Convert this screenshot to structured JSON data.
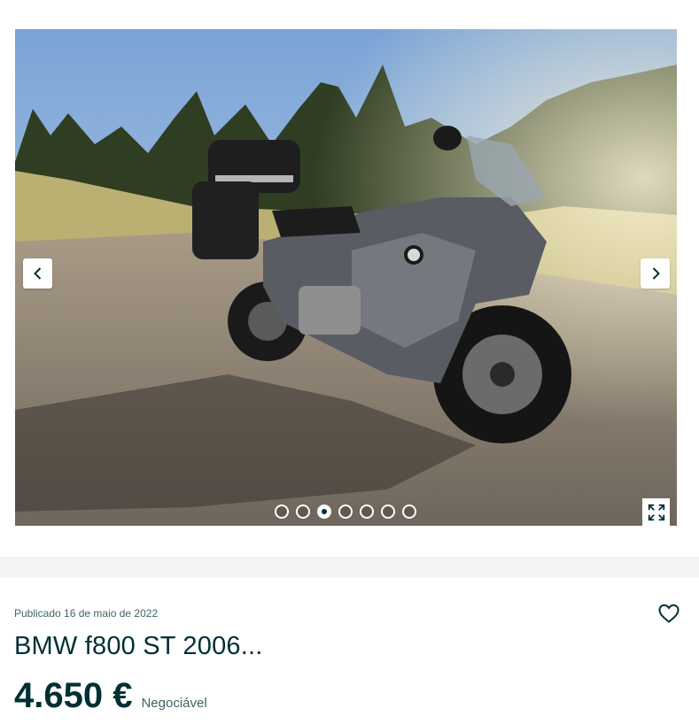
{
  "gallery": {
    "image_alt": "BMW f800 ST motorcycle parked on cobblestones",
    "prev_icon": "chevron-left-icon",
    "next_icon": "chevron-right-icon",
    "expand_icon": "expand-icon",
    "dots": {
      "total": 7,
      "active_index": 2
    }
  },
  "listing": {
    "published": "Publicado 16 de maio de 2022",
    "title": "BMW f800 ST 2006...",
    "price": "4.650 €",
    "negotiable": "Negociável",
    "favorite_icon": "heart-icon"
  },
  "colors": {
    "text_primary": "#002f34",
    "text_secondary": "#406367",
    "band": "#f2f4f5"
  }
}
